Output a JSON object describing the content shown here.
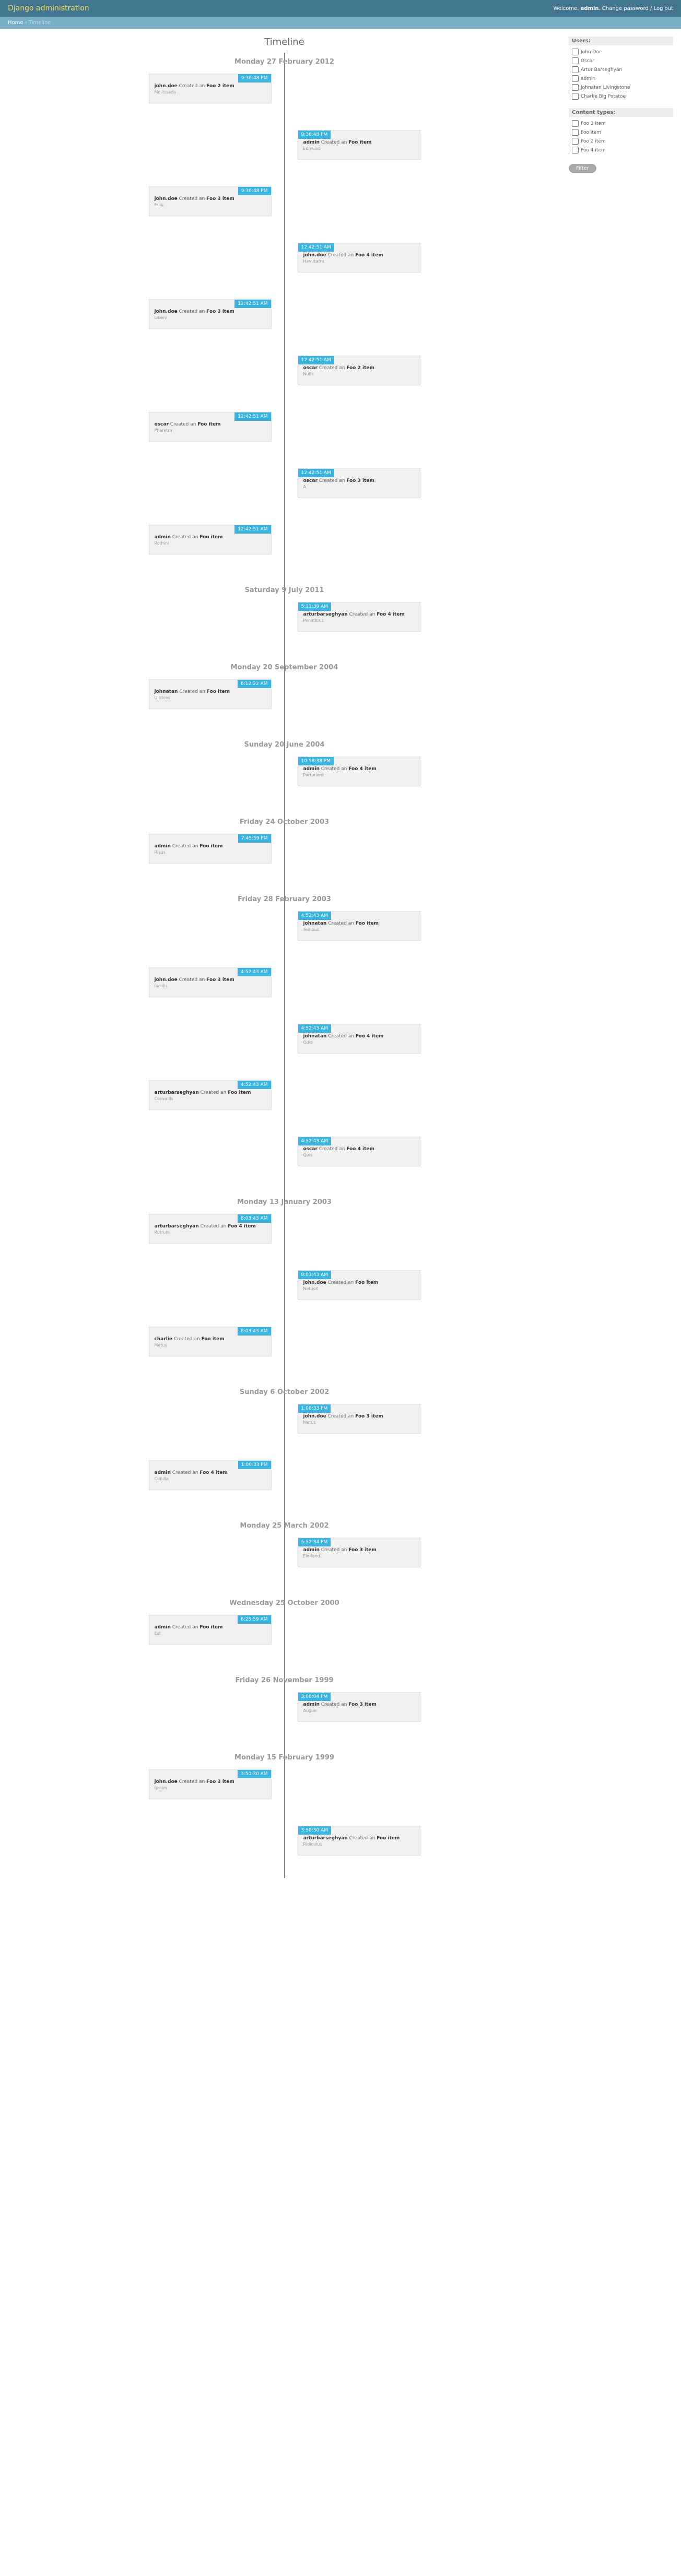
{
  "header": {
    "title": "Django administration",
    "welcome": "Welcome,",
    "user": "admin",
    "change_pw": "Change password",
    "logout": "Log out"
  },
  "breadcrumbs": {
    "home": "Home",
    "current": "Timeline"
  },
  "page_title": "Timeline",
  "sidebar": {
    "users_label": "Users:",
    "users": [
      "John Doe",
      "Oscar",
      "Artur Barseghyan",
      "admin",
      "Johnatan Livingstone",
      "Charlie Big Potatoe"
    ],
    "ct_label": "Content types:",
    "cts": [
      "Foo 3 item",
      "Foo item",
      "Foo 2 item",
      "Foo 4 item"
    ],
    "filter_btn": "Filter"
  },
  "groups": [
    {
      "date": "Monday 27 February 2012",
      "items": [
        {
          "side": "left",
          "time": "9:36:48 PM",
          "who": "john.doe",
          "action": "Created an",
          "what": "Foo 2 item",
          "sub": "Mollissada"
        },
        {
          "side": "right",
          "time": "9:36:48 PM",
          "who": "admin",
          "action": "Created an",
          "what": "Foo item",
          "sub": "Ediyulso"
        },
        {
          "side": "left",
          "time": "9:36:48 PM",
          "who": "john.doe",
          "action": "Created an",
          "what": "Foo 3 item",
          "sub": "Euiu"
        },
        {
          "side": "right",
          "time": "12:42:51 AM",
          "who": "john.doe",
          "action": "Created an",
          "what": "Foo 4 item",
          "sub": "Hevirtafra"
        },
        {
          "side": "left",
          "time": "12:42:51 AM",
          "who": "john.doe",
          "action": "Created an",
          "what": "Foo 3 item",
          "sub": "Libero"
        },
        {
          "side": "right",
          "time": "12:42:51 AM",
          "who": "oscar",
          "action": "Created an",
          "what": "Foo 2 item",
          "sub": "Nulla"
        },
        {
          "side": "left",
          "time": "12:42:51 AM",
          "who": "oscar",
          "action": "Created an",
          "what": "Foo item",
          "sub": "Pharetra"
        },
        {
          "side": "right",
          "time": "12:42:51 AM",
          "who": "oscar",
          "action": "Created an",
          "what": "Foo 3 item",
          "sub": "A"
        },
        {
          "side": "left",
          "time": "12:42:51 AM",
          "who": "admin",
          "action": "Created an",
          "what": "Foo item",
          "sub": "Rothini"
        }
      ]
    },
    {
      "date": "Saturday 9 July 2011",
      "items": [
        {
          "side": "right",
          "time": "5:11:39 AM",
          "who": "arturbarseghyan",
          "action": "Created an",
          "what": "Foo 4 item",
          "sub": "Penatibus"
        }
      ]
    },
    {
      "date": "Monday 20 September 2004",
      "items": [
        {
          "side": "left",
          "time": "6:12:22 AM",
          "who": "johnatan",
          "action": "Created an",
          "what": "Foo item",
          "sub": "Ultrices"
        }
      ]
    },
    {
      "date": "Sunday 20 June 2004",
      "items": [
        {
          "side": "right",
          "time": "10:58:38 PM",
          "who": "admin",
          "action": "Created an",
          "what": "Foo 4 item",
          "sub": "Parturient"
        }
      ]
    },
    {
      "date": "Friday 24 October 2003",
      "items": [
        {
          "side": "left",
          "time": "7:45:59 PM",
          "who": "admin",
          "action": "Created an",
          "what": "Foo item",
          "sub": "Risus"
        }
      ]
    },
    {
      "date": "Friday 28 February 2003",
      "items": [
        {
          "side": "right",
          "time": "4:52:43 AM",
          "who": "johnatan",
          "action": "Created an",
          "what": "Foo item",
          "sub": "Tempus"
        },
        {
          "side": "left",
          "time": "4:52:43 AM",
          "who": "john.doe",
          "action": "Created an",
          "what": "Foo 3 item",
          "sub": "Iaculis"
        },
        {
          "side": "right",
          "time": "4:52:43 AM",
          "who": "johnatan",
          "action": "Created an",
          "what": "Foo 4 item",
          "sub": "Odio"
        },
        {
          "side": "left",
          "time": "4:52:43 AM",
          "who": "arturbarseghyan",
          "action": "Created an",
          "what": "Foo item",
          "sub": "Convallis"
        },
        {
          "side": "right",
          "time": "4:52:43 AM",
          "who": "oscar",
          "action": "Created an",
          "what": "Foo 4 item",
          "sub": "Quis"
        }
      ]
    },
    {
      "date": "Monday 13 January 2003",
      "items": [
        {
          "side": "left",
          "time": "8:03:43 AM",
          "who": "arturbarseghyan",
          "action": "Created an",
          "what": "Foo 4 item",
          "sub": "Rutrum"
        },
        {
          "side": "right",
          "time": "8:03:43 AM",
          "who": "john.doe",
          "action": "Created an",
          "what": "Foo item",
          "sub": "Netus4"
        },
        {
          "side": "left",
          "time": "8:03:43 AM",
          "who": "charlie",
          "action": "Created an",
          "what": "Foo item",
          "sub": "Metus"
        }
      ]
    },
    {
      "date": "Sunday 6 October 2002",
      "items": [
        {
          "side": "right",
          "time": "1:00:33 PM",
          "who": "john.doe",
          "action": "Created an",
          "what": "Foo 3 item",
          "sub": "Metus"
        },
        {
          "side": "left",
          "time": "1:00:33 PM",
          "who": "admin",
          "action": "Created an",
          "what": "Foo 4 item",
          "sub": "Cubilia"
        }
      ]
    },
    {
      "date": "Monday 25 March 2002",
      "items": [
        {
          "side": "right",
          "time": "5:52:34 PM",
          "who": "admin",
          "action": "Created an",
          "what": "Foo 3 item",
          "sub": "Eleifend"
        }
      ]
    },
    {
      "date": "Wednesday 25 October 2000",
      "items": [
        {
          "side": "left",
          "time": "6:25:59 AM",
          "who": "admin",
          "action": "Created an",
          "what": "Foo item",
          "sub": "Est"
        }
      ]
    },
    {
      "date": "Friday 26 November 1999",
      "items": [
        {
          "side": "right",
          "time": "3:00:04 PM",
          "who": "admin",
          "action": "Created an",
          "what": "Foo 3 item",
          "sub": "Augue"
        }
      ]
    },
    {
      "date": "Monday 15 February 1999",
      "items": [
        {
          "side": "left",
          "time": "3:50:30 AM",
          "who": "john.doe",
          "action": "Created an",
          "what": "Foo 3 item",
          "sub": "Ipsum"
        },
        {
          "side": "right",
          "time": "3:50:30 AM",
          "who": "arturbarseghyan",
          "action": "Created an",
          "what": "Foo item",
          "sub": "Ridiculus"
        }
      ]
    }
  ]
}
